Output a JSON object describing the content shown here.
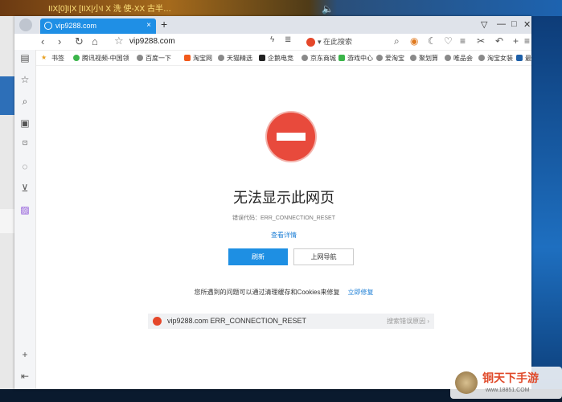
{
  "tab": {
    "title": "vip9288.com",
    "close": "×",
    "new_tab": "+"
  },
  "window_controls": {
    "pin": "▽",
    "minimize": "—",
    "maximize": "□",
    "close": "✕"
  },
  "nav": {
    "back": "‹",
    "forward": "›",
    "reload": "↻",
    "home": "⌂",
    "bookmark_star": "☆",
    "url": "vip9288.com"
  },
  "search": {
    "placeholder": "在此搜索",
    "badge_color": "#e5472a"
  },
  "bookmarks": {
    "label": "书签",
    "items": [
      "腾讯视频-中国领",
      "百度一下",
      "淘宝网",
      "天猫精选",
      "企鹅电竞",
      "京东商城",
      "游戏中心",
      "爱淘宝",
      "聚划算",
      "唯品会",
      "淘宝女装",
      "最新电"
    ]
  },
  "error": {
    "heading": "无法显示此网页",
    "code": "错误代码：ERR_CONNECTION_RESET",
    "details_link": "查看详情",
    "refresh_button": "刷新",
    "nav_button": "上网导航",
    "fix_text": "您所遇到的问题可以通过清理缓存和Cookies来修复",
    "fix_link": "立即修复",
    "search_text": "vip9288.com ERR_CONNECTION_RESET",
    "search_reason": "搜索错误原因 ›"
  },
  "desktop": {
    "banner_text": "IIX[0]I|X  [IIX|小I X 洗 使-XX 古半…",
    "watermark_title": "铜天下手游",
    "watermark_url": "www.18851.COM"
  },
  "colors": {
    "accent": "#1e8fe3",
    "stop_red": "#e84a3c"
  }
}
